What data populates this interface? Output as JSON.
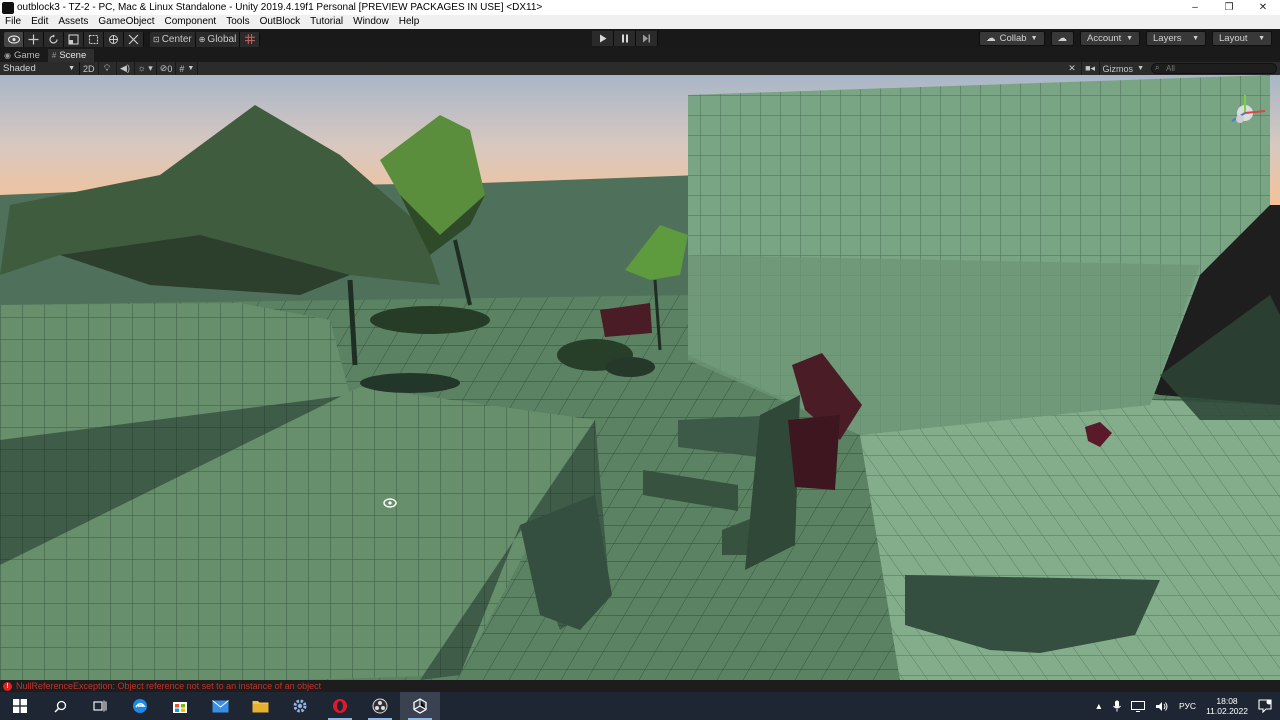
{
  "window": {
    "title": "outblock3 - TZ-2 - PC, Mac & Linux Standalone - Unity 2019.4.19f1 Personal [PREVIEW PACKAGES IN USE] <DX11>",
    "minimize_glyph": "–",
    "maximize_glyph": "❐",
    "close_glyph": "✕"
  },
  "menu": [
    "File",
    "Edit",
    "Assets",
    "GameObject",
    "Component",
    "Tools",
    "OutBlock",
    "Tutorial",
    "Window",
    "Help"
  ],
  "toolbar": {
    "pivot_label": "Center",
    "space_label": "Global",
    "collab_label": "Collab",
    "account_label": "Account",
    "layers_label": "Layers",
    "layout_label": "Layout"
  },
  "tabs": [
    "Game",
    "Scene"
  ],
  "scene_toolbar": {
    "shading_mode": "Shaded",
    "mode_2d": "2D",
    "fx_count": "0",
    "gizmos_label": "Gizmos",
    "search_placeholder": "All"
  },
  "status": {
    "error_message": "NullReferenceException: Object reference not set to an instance of an object"
  },
  "taskbar": {
    "language": "РУС",
    "time": "18:08",
    "date": "11.02.2022"
  },
  "colors": {
    "sky_top": "#b8c4d4",
    "sky_horizon": "#f2c8a0",
    "grid_surface": "#6a9670",
    "shadow_surface": "#3a5646",
    "cube_color": "#4a1c26",
    "error_red": "#c0332b"
  }
}
